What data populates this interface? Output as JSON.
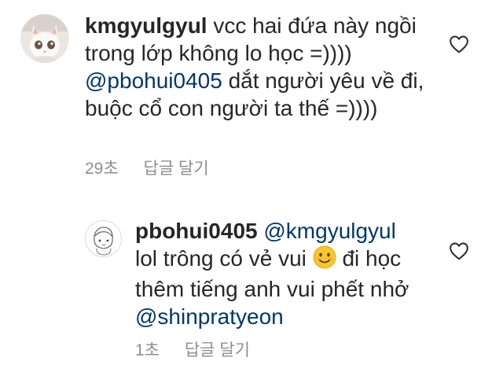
{
  "comments": [
    {
      "username": "kmgyulgyul",
      "text": "vcc hai đứa này ngồi trong lớp không lo học =))))",
      "mention": "@pbohui0405",
      "text2": " dắt người yêu về đi, buộc cổ con người ta thế =))))",
      "time": "29초",
      "reply_label": "답글 달기"
    },
    {
      "username": "pbohui0405",
      "mention": "@kmgyulgyul",
      "text": "lol trông có vẻ vui",
      "emoji": "smiling-face-emoji",
      "text2": " đi học thêm tiếng anh vui phết nhở ",
      "mention2": "@shinpratyeon",
      "time": "1초",
      "reply_label": "답글 달기"
    }
  ],
  "colors": {
    "text": "#262626",
    "mention": "#00376b",
    "meta": "#8e8e8e"
  }
}
